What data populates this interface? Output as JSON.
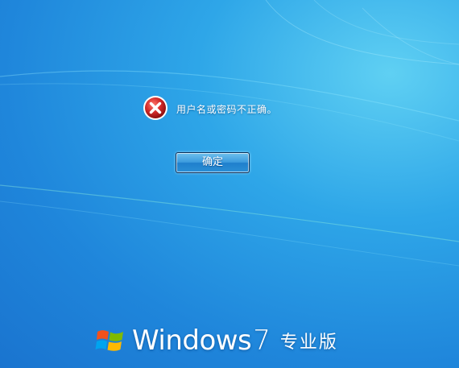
{
  "dialog": {
    "message": "用户名或密码不正确。",
    "ok_label": "确定",
    "icon": "error-icon"
  },
  "branding": {
    "product": "Windows",
    "version": "7",
    "edition": "专业版",
    "logo": "windows-flag-icon"
  },
  "colors": {
    "background": "#1f86db",
    "error_red": "#d42a2a",
    "button_blue": "#3b9ade"
  }
}
